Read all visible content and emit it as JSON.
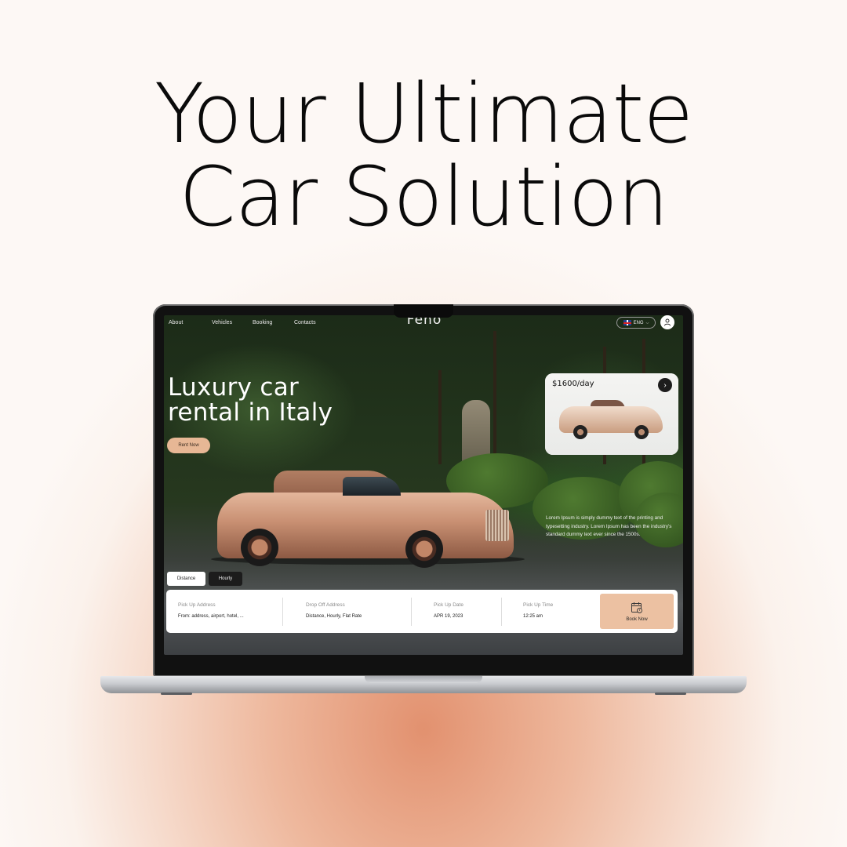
{
  "headline": {
    "line1": "Your Ultimate",
    "line2": "Car Solution"
  },
  "site": {
    "brand": "Feno",
    "nav": [
      "About",
      "Vehicles",
      "Booking",
      "Contacts"
    ],
    "language": "ENG",
    "hero": {
      "line1": "Luxury car",
      "line2": "rental in Italy",
      "cta": "Rent Now"
    },
    "price_card": {
      "price": "$1600/day"
    },
    "description": "Lorem Ipsum is simply dummy text of the printing and typesetting industry. Lorem Ipsum has been the industry's standard dummy text ever since the 1500s.",
    "tabs": [
      "Distance",
      "Hourly"
    ],
    "booking": {
      "pickup_label": "Pick Up Address",
      "pickup_value": "From: address, airport, hotel, ...",
      "dropoff_label": "Drop Off Address",
      "dropoff_value": "Distance, Hourly, Flat Rate",
      "date_label": "Pick Up Date",
      "date_value": "APR 19, 2023",
      "time_label": "Pick Up Time",
      "time_value": "12:25 am",
      "book_label": "Book Now"
    }
  },
  "colors": {
    "accent": "#ecc1a2",
    "cta": "#e7b795",
    "dark": "#1c1c1c"
  },
  "icons": [
    "flag-uk-icon",
    "chevron-down-icon",
    "user-icon",
    "arrow-right-icon",
    "calendar-icon"
  ]
}
